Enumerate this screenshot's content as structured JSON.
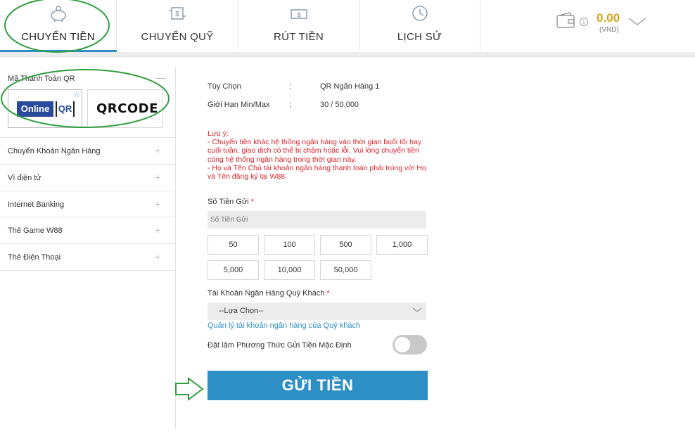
{
  "tabs": [
    {
      "label": "CHUYỂN TIỀN",
      "icon": "piggy-bank-icon",
      "active": true
    },
    {
      "label": "CHUYỂN QUỸ",
      "icon": "money-transfer-icon",
      "active": false
    },
    {
      "label": "RÚT TIỀN",
      "icon": "cash-withdraw-icon",
      "active": false
    },
    {
      "label": "LỊCH SỬ",
      "icon": "history-clock-icon",
      "active": false
    }
  ],
  "wallet": {
    "balance": "0.00",
    "currency": "(VND)",
    "info": "i"
  },
  "sidebar": {
    "qr_section": {
      "title": "Mã Thanh Toán QR",
      "collapse_symbol": "—",
      "cards": [
        {
          "online": "Online",
          "qr": "QR"
        },
        {
          "text": "QRCODE"
        }
      ]
    },
    "items": [
      {
        "label": "Chuyển Khoản Ngân Hàng"
      },
      {
        "label": "Ví điện tử"
      },
      {
        "label": "Internet Banking"
      },
      {
        "label": "Thẻ Game W88"
      },
      {
        "label": "Thẻ Điện Thoại"
      }
    ],
    "plus_symbol": "+"
  },
  "form": {
    "option_label": "Tùy Chọn",
    "option_value": "QR Ngân Hàng 1",
    "limit_label": "Giới Hạn Min/Max",
    "limit_value": "30 / 50,000",
    "colon": ":",
    "notice": "Lưu ý:\n- Chuyển tiền khác hệ thống ngân hàng vào thời gian buổi tối hay cuối tuần, giao dịch có thể bị chậm hoặc lỗi. Vui lòng chuyển tiền cùng hệ thống ngân hàng trong thời gian này.\n- Họ và Tên Chủ tài khoản ngân hàng thanh toán phải trùng với Họ và Tên đăng ký tại W88.",
    "amount_label": "Số Tiền Gửi",
    "amount_placeholder": "Số Tiền Gửi",
    "required_mark": "*",
    "amount_chips": [
      "50",
      "100",
      "500",
      "1,000",
      "5,000",
      "10,000",
      "50,000"
    ],
    "account_label": "Tài Khoản Ngân Hàng Quý Khách",
    "account_select": "--Lựa Chọn--",
    "manage_link": "Quản lý tài khoản ngân hàng của Quý khách",
    "default_label": "Đặt làm Phương Thức Gửi Tiền Mặc Định",
    "default_toggle_on": false,
    "submit_label": "GỬI TIỀN"
  },
  "colors": {
    "accent": "#2d8fc4",
    "balance": "#d4a21a",
    "notice": "#d9252a",
    "annotation": "#2e9e3e"
  }
}
